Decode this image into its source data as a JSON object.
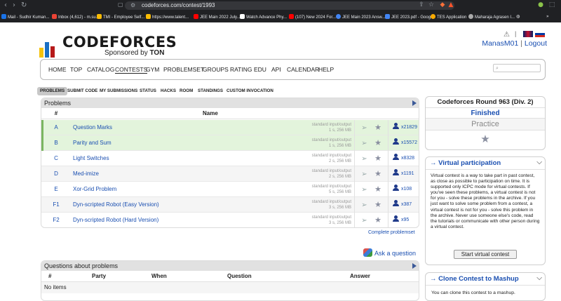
{
  "browser": {
    "url": "codeforces.com/contest/1993",
    "bookmarks": [
      {
        "label": "Mail - Sudhir Kuman...",
        "color": "#1a73e8"
      },
      {
        "label": "Inbox (4,612) - m.su...",
        "color": "#ea4335"
      },
      {
        "label": "TMI - Employee Self...",
        "color": "#fbbc04"
      },
      {
        "label": "https://www.talent...",
        "color": "#fbbc04"
      },
      {
        "label": "JEE Main 2022 July...",
        "color": "#ff0000"
      },
      {
        "label": "Watch Advance Phy...",
        "color": "#ffffff"
      },
      {
        "label": "(107) New 2024 For...",
        "color": "#ff0000"
      },
      {
        "label": "JEE Main 2023 Answ...",
        "color": "#4285f4"
      },
      {
        "label": "JEE 2023.pdf - Goog...",
        "color": "#4285f4"
      },
      {
        "label": "TES Application",
        "color": "#f9ab00"
      },
      {
        "label": "Maharaja Agrasen I...",
        "color": "#aaaaaa"
      }
    ]
  },
  "header": {
    "logo_text": "CODEFORCES",
    "sponsored_prefix": "Sponsored by",
    "sponsor": "TON",
    "username": "ManasM01",
    "separator": "|",
    "logout": "Logout"
  },
  "menu": {
    "items": [
      "HOME",
      "TOP",
      "CATALOG",
      "CONTESTS",
      "GYM",
      "PROBLEMSET",
      "GROUPS",
      "RATING",
      "EDU",
      "API",
      "CALENDAR",
      "HELP"
    ],
    "active": "CONTESTS"
  },
  "subtabs": {
    "items": [
      "PROBLEMS",
      "SUBMIT CODE",
      "MY SUBMISSIONS",
      "STATUS",
      "HACKS",
      "ROOM",
      "STANDINGS",
      "CUSTOM INVOCATION"
    ],
    "active": "PROBLEMS"
  },
  "problems": {
    "title": "Problems",
    "col_index": "#",
    "col_name": "Name",
    "rows": [
      {
        "idx": "A",
        "name": "Question Marks",
        "io": "standard input/output",
        "limits": "1 s, 256 MB",
        "solved": "x21829",
        "accepted": true
      },
      {
        "idx": "B",
        "name": "Parity and Sum",
        "io": "standard input/output",
        "limits": "1 s, 256 MB",
        "solved": "x15572",
        "accepted": true
      },
      {
        "idx": "C",
        "name": "Light Switches",
        "io": "standard input/output",
        "limits": "2 s, 256 MB",
        "solved": "x8328",
        "accepted": false
      },
      {
        "idx": "D",
        "name": "Med-imize",
        "io": "standard input/output",
        "limits": "2 s, 256 MB",
        "solved": "x1191",
        "accepted": false
      },
      {
        "idx": "E",
        "name": "Xor-Grid Problem",
        "io": "standard input/output",
        "limits": "5 s, 256 MB",
        "solved": "x108",
        "accepted": false
      },
      {
        "idx": "F1",
        "name": "Dyn-scripted Robot (Easy Version)",
        "io": "standard input/output",
        "limits": "3 s, 256 MB",
        "solved": "x387",
        "accepted": false
      },
      {
        "idx": "F2",
        "name": "Dyn-scripted Robot (Hard Version)",
        "io": "standard input/output",
        "limits": "3 s, 256 MB",
        "solved": "x95",
        "accepted": false
      }
    ],
    "complete_link": "Complete problemset",
    "ask_link": "Ask a question"
  },
  "questions": {
    "title": "Questions about problems",
    "cols": [
      "#",
      "Party",
      "When",
      "Question",
      "Answer"
    ],
    "empty": "No items"
  },
  "sidebar": {
    "contest_name": "Codeforces Round 963 (Div. 2)",
    "status": "Finished",
    "practice": "Practice",
    "virtual": {
      "title": "→ Virtual participation",
      "body": "Virtual contest is a way to take part in past contest, as close as possible to participation on time. It is supported only ICPC mode for virtual contests. If you've seen these problems, a virtual contest is not for you - solve these problems in the archive. If you just want to solve some problem from a contest, a virtual contest is not for you - solve this problem in the archive. Never use someone else's code, read the tutorials or communicate with other person during a virtual contest.",
      "button": "Start virtual contest"
    },
    "clone": {
      "title": "→ Clone Contest to Mashup",
      "body": "You can clone this contest to a mashup."
    }
  }
}
